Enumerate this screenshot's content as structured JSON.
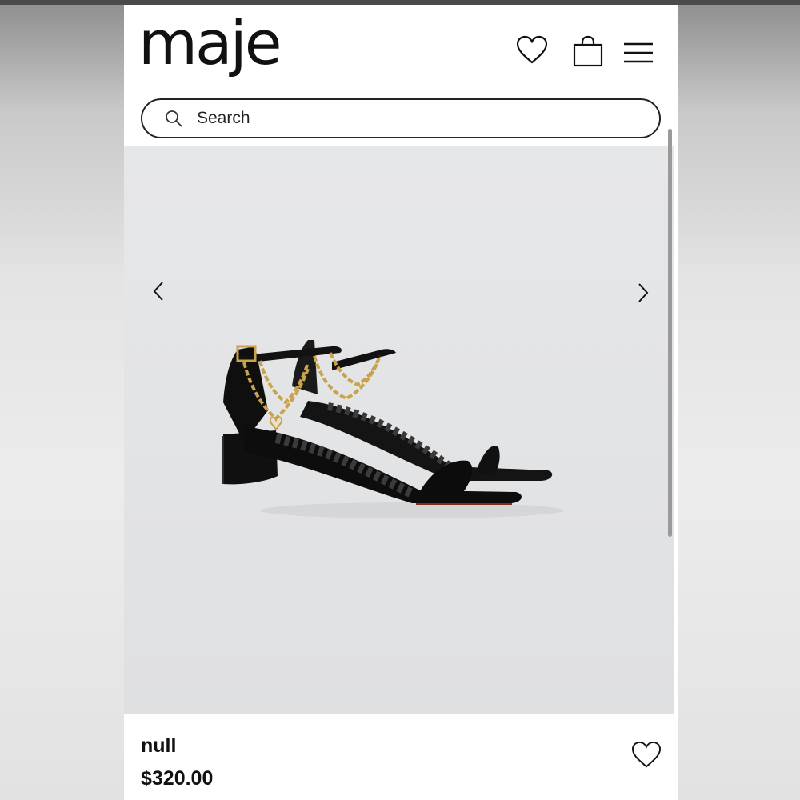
{
  "brand": {
    "logo": "maje"
  },
  "header": {
    "icons": [
      "heart-icon",
      "shopping-bag-icon",
      "menu-icon"
    ]
  },
  "search": {
    "placeholder": "Search"
  },
  "gallery": {
    "image_subject": "black-heeled-sandal-with-gold-chain",
    "nav_icons": [
      "chevron-left-icon",
      "chevron-right-icon"
    ]
  },
  "product": {
    "name": "null",
    "price": "$320.00"
  },
  "colors": {
    "text": "#111111",
    "background": "#ffffff",
    "image_background": "#e3e4e6",
    "chain_gold": "#c9a24a"
  }
}
